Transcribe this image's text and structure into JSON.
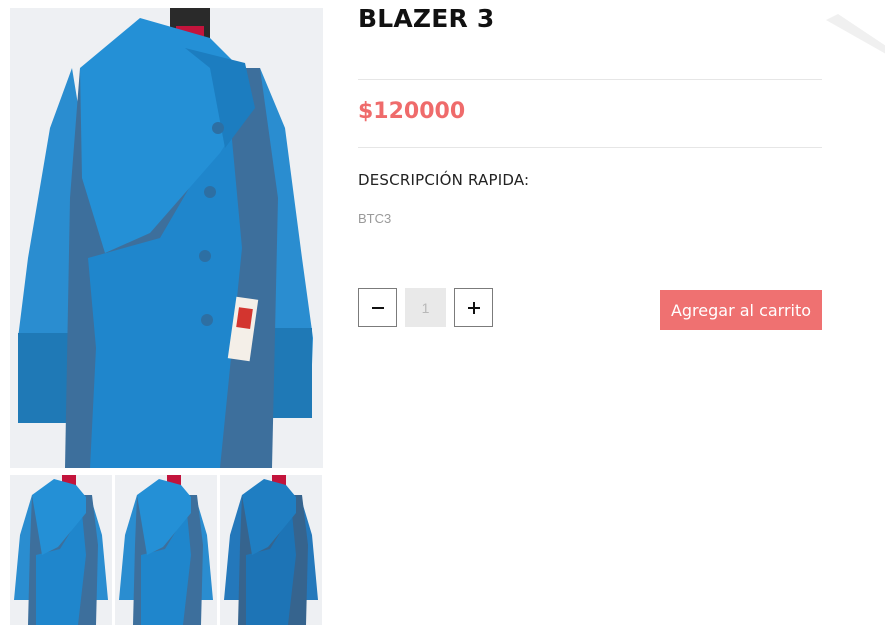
{
  "product": {
    "title": "BLAZER 3",
    "price": "$120000",
    "description_heading": "DESCRIPCIÓN RAPIDA:",
    "description_text": "BTC3"
  },
  "quantity": {
    "decrement_icon": "minus-icon",
    "increment_icon": "plus-icon",
    "value": "1"
  },
  "cart": {
    "add_label": "Agregar al carrito"
  },
  "gallery": {
    "thumbnail_count": 3
  },
  "colors": {
    "accent": "#ef7171",
    "price": "#ef6b6b",
    "coat_blue": "#2d8fd0"
  }
}
